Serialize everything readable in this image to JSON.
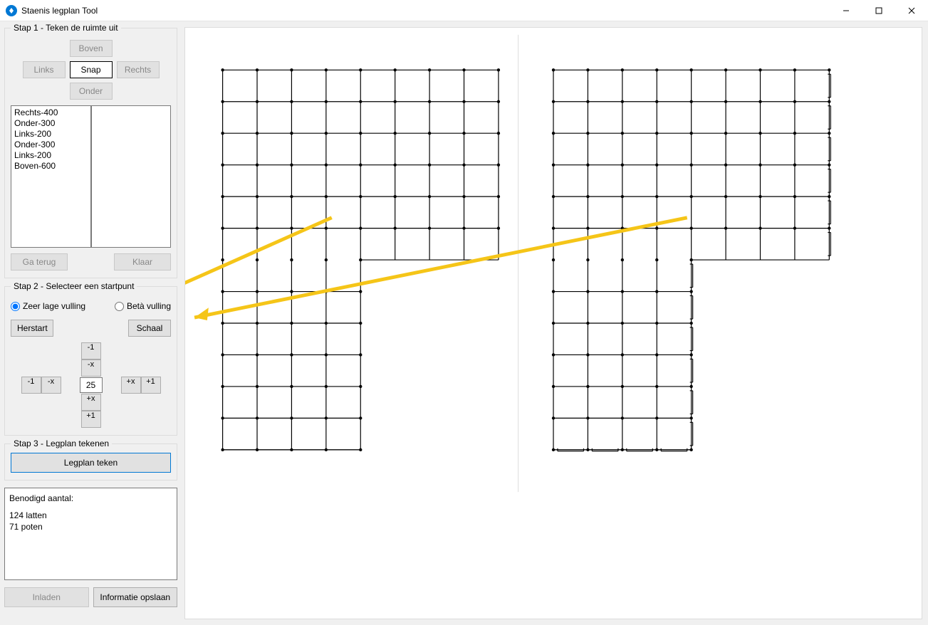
{
  "window": {
    "title": "Staenis legplan Tool"
  },
  "step1": {
    "legend": "Stap 1 - Teken de ruimte uit",
    "up": "Boven",
    "left": "Links",
    "right": "Rechts",
    "down": "Onder",
    "snap": "Snap",
    "back": "Ga terug",
    "done": "Klaar",
    "moves": [
      "Rechts-400",
      "Onder-300",
      "Links-200",
      "Onder-300",
      "Links-200",
      "Boven-600"
    ]
  },
  "step2": {
    "legend": "Stap 2 - Selecteer een startpunt",
    "radio_low": "Zeer lage vulling",
    "radio_beta": "Betà vulling",
    "restart": "Herstart",
    "scale": "Schaal",
    "value": "25",
    "minus1": "-1",
    "plus1": "+1",
    "minusx": "-x",
    "plusx": "+x"
  },
  "step3": {
    "legend": "Stap 3 - Legplan tekenen",
    "draw": "Legplan teken"
  },
  "results": {
    "heading": "Benodigd aantal:",
    "line1": "124 latten",
    "line2": "71 poten"
  },
  "bottom": {
    "load": "Inladen",
    "save": "Informatie opslaan"
  }
}
